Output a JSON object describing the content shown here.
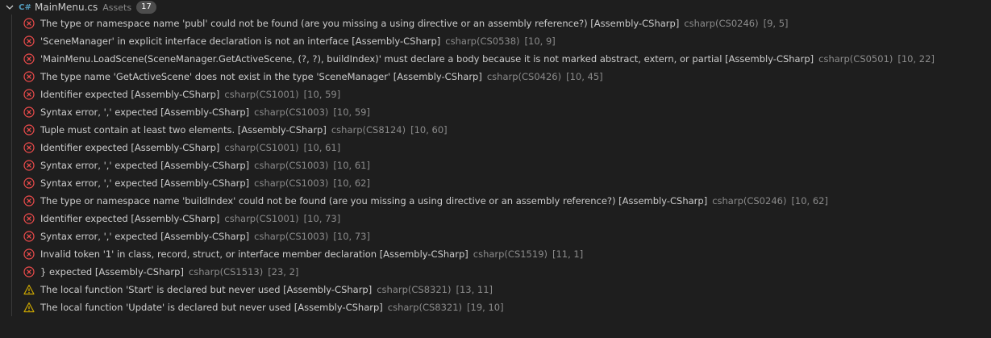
{
  "file": {
    "name": "MainMenu.cs",
    "folder": "Assets",
    "count": "17",
    "icon": "csharp-file-icon"
  },
  "colors": {
    "error": "#f14c4c",
    "warning": "#cca700"
  },
  "problems": [
    {
      "severity": "error",
      "message": "The type or namespace name 'publ' could not be found (are you missing a using directive or an assembly reference?) [Assembly-CSharp]",
      "code": "csharp(CS0246)",
      "position": "[9, 5]"
    },
    {
      "severity": "error",
      "message": "'SceneManager' in explicit interface declaration is not an interface [Assembly-CSharp]",
      "code": "csharp(CS0538)",
      "position": "[10, 9]"
    },
    {
      "severity": "error",
      "message": "'MainMenu.LoadScene(SceneManager.GetActiveScene, (?, ?), buildIndex)' must declare a body because it is not marked abstract, extern, or partial [Assembly-CSharp]",
      "code": "csharp(CS0501)",
      "position": "[10, 22]"
    },
    {
      "severity": "error",
      "message": "The type name 'GetActiveScene' does not exist in the type 'SceneManager' [Assembly-CSharp]",
      "code": "csharp(CS0426)",
      "position": "[10, 45]"
    },
    {
      "severity": "error",
      "message": "Identifier expected [Assembly-CSharp]",
      "code": "csharp(CS1001)",
      "position": "[10, 59]"
    },
    {
      "severity": "error",
      "message": "Syntax error, ',' expected [Assembly-CSharp]",
      "code": "csharp(CS1003)",
      "position": "[10, 59]"
    },
    {
      "severity": "error",
      "message": "Tuple must contain at least two elements. [Assembly-CSharp]",
      "code": "csharp(CS8124)",
      "position": "[10, 60]"
    },
    {
      "severity": "error",
      "message": "Identifier expected [Assembly-CSharp]",
      "code": "csharp(CS1001)",
      "position": "[10, 61]"
    },
    {
      "severity": "error",
      "message": "Syntax error, ',' expected [Assembly-CSharp]",
      "code": "csharp(CS1003)",
      "position": "[10, 61]"
    },
    {
      "severity": "error",
      "message": "Syntax error, ',' expected [Assembly-CSharp]",
      "code": "csharp(CS1003)",
      "position": "[10, 62]"
    },
    {
      "severity": "error",
      "message": "The type or namespace name 'buildIndex' could not be found (are you missing a using directive or an assembly reference?) [Assembly-CSharp]",
      "code": "csharp(CS0246)",
      "position": "[10, 62]"
    },
    {
      "severity": "error",
      "message": "Identifier expected [Assembly-CSharp]",
      "code": "csharp(CS1001)",
      "position": "[10, 73]"
    },
    {
      "severity": "error",
      "message": "Syntax error, ',' expected [Assembly-CSharp]",
      "code": "csharp(CS1003)",
      "position": "[10, 73]"
    },
    {
      "severity": "error",
      "message": "Invalid token '1' in class, record, struct, or interface member declaration [Assembly-CSharp]",
      "code": "csharp(CS1519)",
      "position": "[11, 1]"
    },
    {
      "severity": "error",
      "message": "} expected [Assembly-CSharp]",
      "code": "csharp(CS1513)",
      "position": "[23, 2]"
    },
    {
      "severity": "warning",
      "message": "The local function 'Start' is declared but never used [Assembly-CSharp]",
      "code": "csharp(CS8321)",
      "position": "[13, 11]"
    },
    {
      "severity": "warning",
      "message": "The local function 'Update' is declared but never used [Assembly-CSharp]",
      "code": "csharp(CS8321)",
      "position": "[19, 10]"
    }
  ]
}
